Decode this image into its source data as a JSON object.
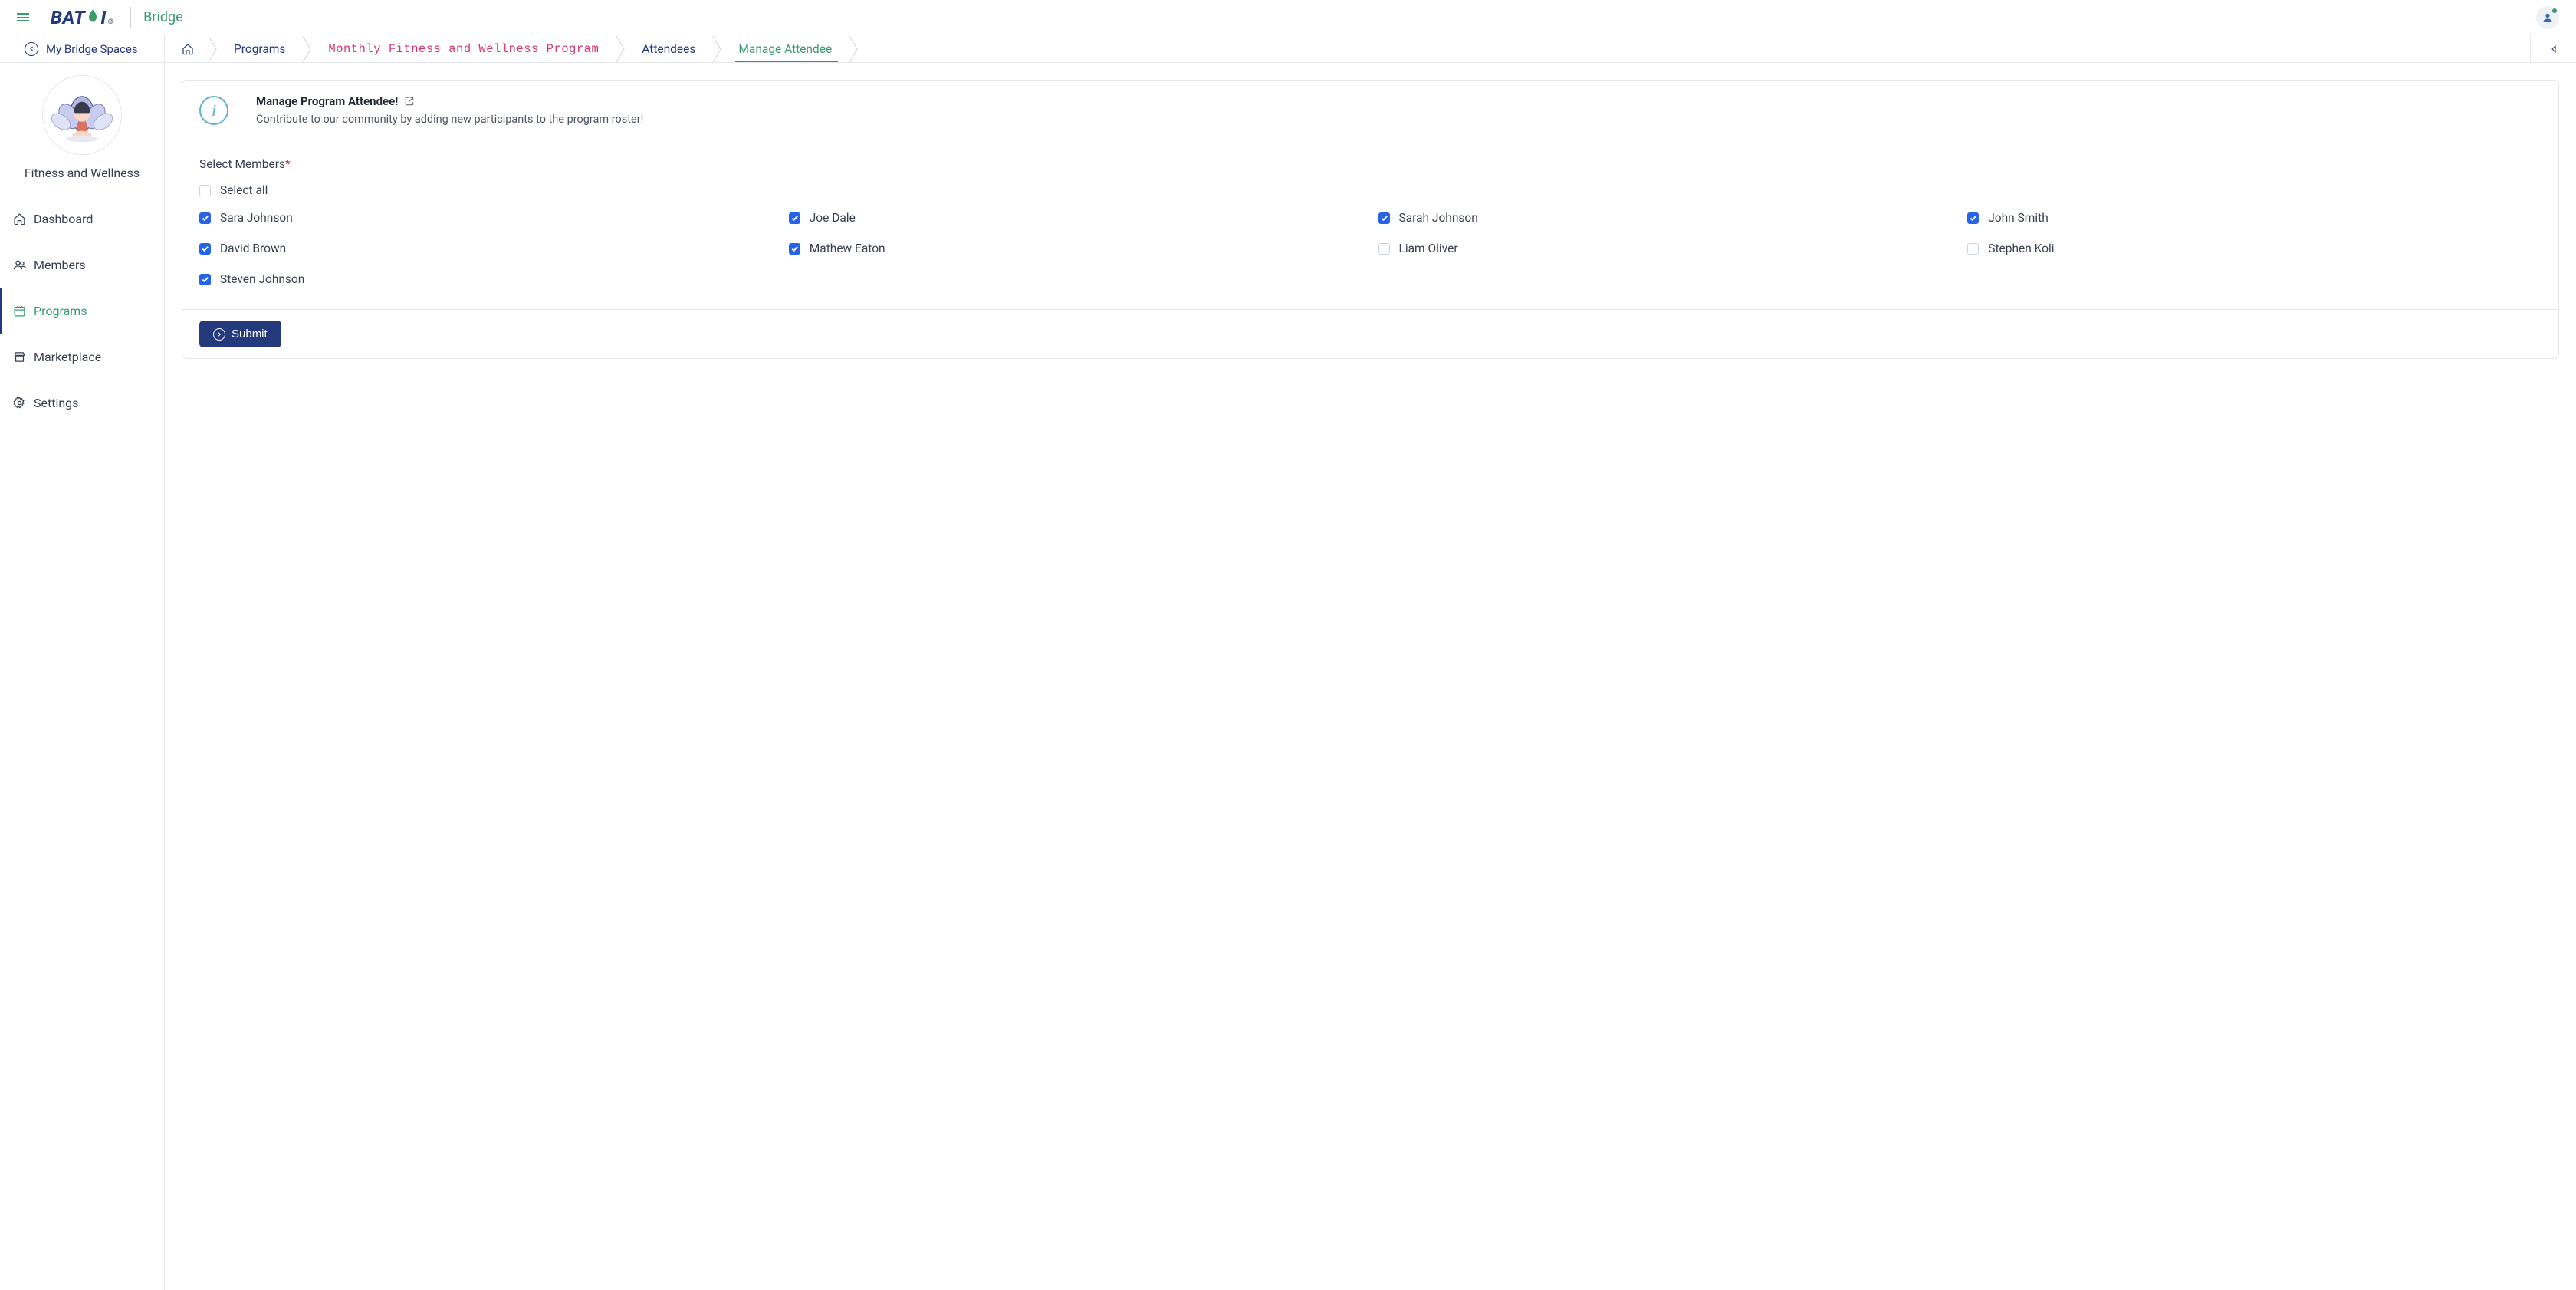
{
  "header": {
    "app_name": "Bridge",
    "logo_text_1": "BAT",
    "logo_text_2": "I",
    "logo_reg": "®"
  },
  "breadcrumb": {
    "back_label": "My Bridge Spaces",
    "items": [
      {
        "label": "Programs"
      },
      {
        "label": "Monthly Fitness and Wellness Program"
      },
      {
        "label": "Attendees"
      },
      {
        "label": "Manage Attendee"
      }
    ]
  },
  "sidebar": {
    "space_name": "Fitness and Wellness",
    "nav": [
      {
        "label": "Dashboard",
        "icon": "home"
      },
      {
        "label": "Members",
        "icon": "members"
      },
      {
        "label": "Programs",
        "icon": "programs",
        "active": true
      },
      {
        "label": "Marketplace",
        "icon": "marketplace"
      },
      {
        "label": "Settings",
        "icon": "settings"
      }
    ]
  },
  "info": {
    "title": "Manage Program Attendee!",
    "subtitle": "Contribute to our community by adding new participants to the program roster!",
    "icon_char": "i"
  },
  "form": {
    "field_label": "Select Members",
    "select_all_label": "Select all",
    "select_all_checked": false,
    "members": [
      {
        "name": "Sara Johnson",
        "checked": true
      },
      {
        "name": "Joe Dale",
        "checked": true
      },
      {
        "name": "Sarah Johnson",
        "checked": true
      },
      {
        "name": "John Smith",
        "checked": true
      },
      {
        "name": "David Brown",
        "checked": true
      },
      {
        "name": "Mathew Eaton",
        "checked": true
      },
      {
        "name": "Liam Oliver",
        "checked": false
      },
      {
        "name": "Stephen Koli",
        "checked": false
      },
      {
        "name": "Steven Johnson",
        "checked": true
      }
    ],
    "submit_label": "Submit"
  }
}
